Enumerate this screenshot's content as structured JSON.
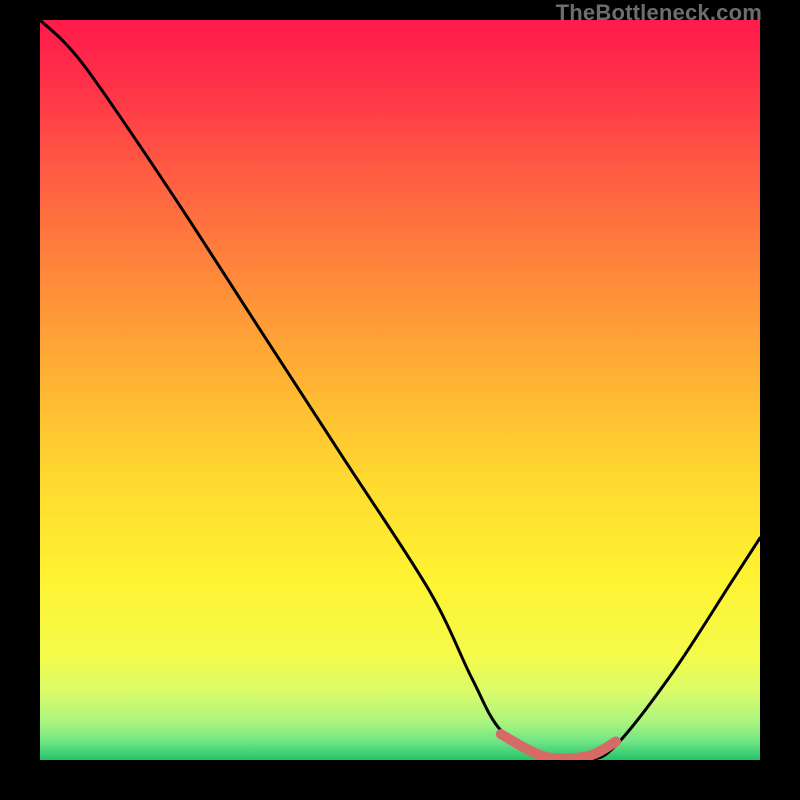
{
  "attribution": "TheBottleneck.com",
  "chart_data": {
    "type": "line",
    "title": "",
    "xlabel": "",
    "ylabel": "",
    "xlim": [
      0,
      100
    ],
    "ylim": [
      0,
      100
    ],
    "series": [
      {
        "name": "bottleneck-curve",
        "x": [
          0,
          6,
          18,
          30,
          42,
          54,
          60,
          64,
          70,
          76,
          80,
          88,
          96,
          100
        ],
        "y": [
          100,
          94,
          77,
          59,
          41,
          23,
          11,
          4,
          0,
          0,
          2,
          12,
          24,
          30
        ]
      }
    ],
    "highlight_segment": {
      "name": "optimal-range",
      "x": [
        64,
        70,
        76,
        80
      ],
      "y": [
        3.5,
        0.5,
        0.5,
        2.5
      ]
    },
    "gradient_stops": [
      {
        "offset": 0.0,
        "color": "#ff1a4b"
      },
      {
        "offset": 0.08,
        "color": "#ff2f49"
      },
      {
        "offset": 0.2,
        "color": "#ff5a43"
      },
      {
        "offset": 0.35,
        "color": "#ff8a3a"
      },
      {
        "offset": 0.5,
        "color": "#ffb733"
      },
      {
        "offset": 0.62,
        "color": "#ffd930"
      },
      {
        "offset": 0.75,
        "color": "#fff232"
      },
      {
        "offset": 0.86,
        "color": "#f4fb4a"
      },
      {
        "offset": 0.91,
        "color": "#d8fb6b"
      },
      {
        "offset": 0.95,
        "color": "#a8f47e"
      },
      {
        "offset": 0.975,
        "color": "#6fe585"
      },
      {
        "offset": 1.0,
        "color": "#23c46b"
      }
    ],
    "curve_color": "#000000",
    "highlight_color": "#d66a66"
  }
}
